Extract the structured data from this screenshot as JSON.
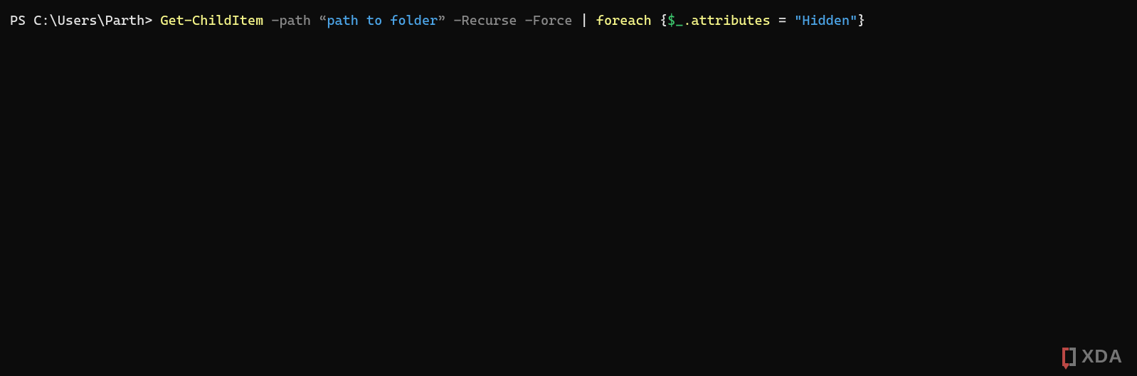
{
  "terminal": {
    "prompt": "PS C:\\Users\\Parth> ",
    "tokens": {
      "cmdlet": "Get-ChildItem",
      "path_flag": " -path ",
      "open_smartquote": "“",
      "path_arg": "path to folder",
      "close_smartquote": "”",
      "recurse": " -Recurse -Force ",
      "pipe": "| ",
      "foreach": "foreach ",
      "open_brace": "{",
      "dollar_under": "$_",
      "dot_attr": ".attributes",
      "equals": " = ",
      "hidden_str": "\"Hidden\"",
      "close_brace": "}"
    }
  },
  "watermark": {
    "text": "XDA"
  }
}
